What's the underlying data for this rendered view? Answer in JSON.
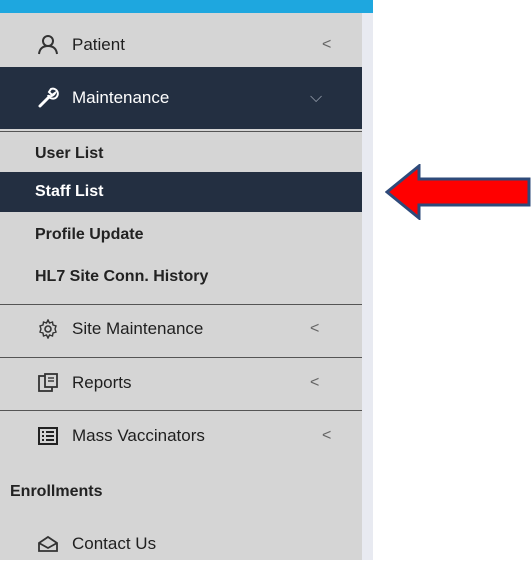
{
  "menu": {
    "patient": {
      "label": "Patient",
      "icon": "user-icon",
      "chevron": "<"
    },
    "maintenance": {
      "label": "Maintenance",
      "icon": "wrench-icon",
      "chevron": "⌵"
    },
    "sub_items": [
      "User List",
      "Staff List",
      "Profile Update",
      "HL7 Site Conn. History"
    ],
    "site_maintenance": {
      "label": "Site Maintenance",
      "icon": "gear-icon",
      "chevron": "<"
    },
    "reports": {
      "label": "Reports",
      "icon": "report-icon",
      "chevron": "<"
    },
    "mass_vaccinators": {
      "label": "Mass Vaccinators",
      "icon": "list-box-icon",
      "chevron": "<"
    },
    "enrollments": {
      "label": "Enrollments"
    },
    "contact_us": {
      "label": "Contact Us",
      "icon": "envelope-icon"
    }
  },
  "colors": {
    "active_bg": "#232f41",
    "sidebar_bg": "#d5d5d5",
    "top_accent": "#1ea7df",
    "arrow_fill": "#ff0000",
    "arrow_stroke": "#2e4a7a"
  }
}
